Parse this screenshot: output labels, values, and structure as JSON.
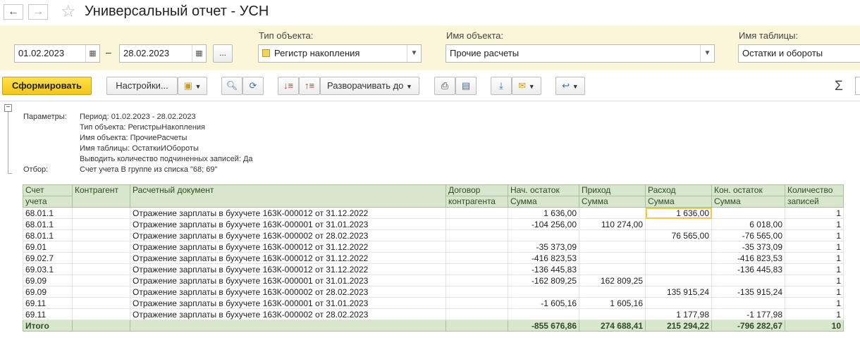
{
  "window": {
    "title": "Универсальный отчет - УСН"
  },
  "filters": {
    "date_from": "01.02.2023",
    "date_sep": "–",
    "date_to": "28.02.2023",
    "period_btn": "...",
    "object_type_label": "Тип объекта:",
    "object_type_value": "Регистр накопления",
    "object_name_label": "Имя объекта:",
    "object_name_value": "Прочие расчеты",
    "table_name_label": "Имя таблицы:",
    "table_name_value": "Остатки и обороты"
  },
  "toolbar": {
    "generate": "Сформировать",
    "settings": "Настройки...",
    "expand_to": "Разворачивать до",
    "sigma": "Σ"
  },
  "params": [
    {
      "k": "Параметры:",
      "v": "Период: 01.02.2023 - 28.02.2023"
    },
    {
      "k": "",
      "v": "Тип объекта: РегистрыНакопления"
    },
    {
      "k": "",
      "v": "Имя объекта: ПрочиеРасчеты"
    },
    {
      "k": "",
      "v": "Имя таблицы: ОстаткиИОбороты"
    },
    {
      "k": "",
      "v": "Выводить количество подчиненных записей: Да"
    },
    {
      "k": "Отбор:",
      "v": "Счет учета В группе из списка \"68; 69\""
    }
  ],
  "table": {
    "headers": {
      "account_1": "Счет",
      "account_2": "учета",
      "counterparty": "Контрагент",
      "document": "Расчетный документ",
      "contract_1": "Договор",
      "contract_2": "контрагента",
      "start_1": "Нач. остаток",
      "start_2": "Сумма",
      "income_1": "Приход",
      "income_2": "Сумма",
      "expense_1": "Расход",
      "expense_2": "Сумма",
      "end_1": "Кон. остаток",
      "end_2": "Сумма",
      "count_1": "Количество",
      "count_2": "записей"
    },
    "rows": [
      {
        "acc": "68.01.1",
        "doc": "Отражение зарплаты в бухучете 163К-000012 от 31.12.2022",
        "start": "1 636,00",
        "income": "",
        "expense": "1 636,00",
        "end": "",
        "count": "1"
      },
      {
        "acc": "68.01.1",
        "doc": "Отражение зарплаты в бухучете 163К-000001 от 31.01.2023",
        "start": "-104 256,00",
        "income": "110 274,00",
        "expense": "",
        "end": "6 018,00",
        "count": "1"
      },
      {
        "acc": "68.01.1",
        "doc": "Отражение зарплаты в бухучете 163К-000002 от 28.02.2023",
        "start": "",
        "income": "",
        "expense": "76 565,00",
        "end": "-76 565,00",
        "count": "1"
      },
      {
        "acc": "69.01",
        "doc": "Отражение зарплаты в бухучете 163К-000012 от 31.12.2022",
        "start": "-35 373,09",
        "income": "",
        "expense": "",
        "end": "-35 373,09",
        "count": "1"
      },
      {
        "acc": "69.02.7",
        "doc": "Отражение зарплаты в бухучете 163К-000012 от 31.12.2022",
        "start": "-416 823,53",
        "income": "",
        "expense": "",
        "end": "-416 823,53",
        "count": "1"
      },
      {
        "acc": "69.03.1",
        "doc": "Отражение зарплаты в бухучете 163К-000012 от 31.12.2022",
        "start": "-136 445,83",
        "income": "",
        "expense": "",
        "end": "-136 445,83",
        "count": "1"
      },
      {
        "acc": "69.09",
        "doc": "Отражение зарплаты в бухучете 163К-000001 от 31.01.2023",
        "start": "-162 809,25",
        "income": "162 809,25",
        "expense": "",
        "end": "",
        "count": "1"
      },
      {
        "acc": "69.09",
        "doc": "Отражение зарплаты в бухучете 163К-000002 от 28.02.2023",
        "start": "",
        "income": "",
        "expense": "135 915,24",
        "end": "-135 915,24",
        "count": "1"
      },
      {
        "acc": "69.11",
        "doc": "Отражение зарплаты в бухучете 163К-000001 от 31.01.2023",
        "start": "-1 605,16",
        "income": "1 605,16",
        "expense": "",
        "end": "",
        "count": "1"
      },
      {
        "acc": "69.11",
        "doc": "Отражение зарплаты в бухучете 163К-000002 от 28.02.2023",
        "start": "",
        "income": "",
        "expense": "1 177,98",
        "end": "-1 177,98",
        "count": "1"
      }
    ],
    "total": {
      "label": "Итого",
      "start": "-855 676,86",
      "income": "274 688,41",
      "expense": "215 294,22",
      "end": "-796 282,67",
      "count": "10"
    }
  }
}
